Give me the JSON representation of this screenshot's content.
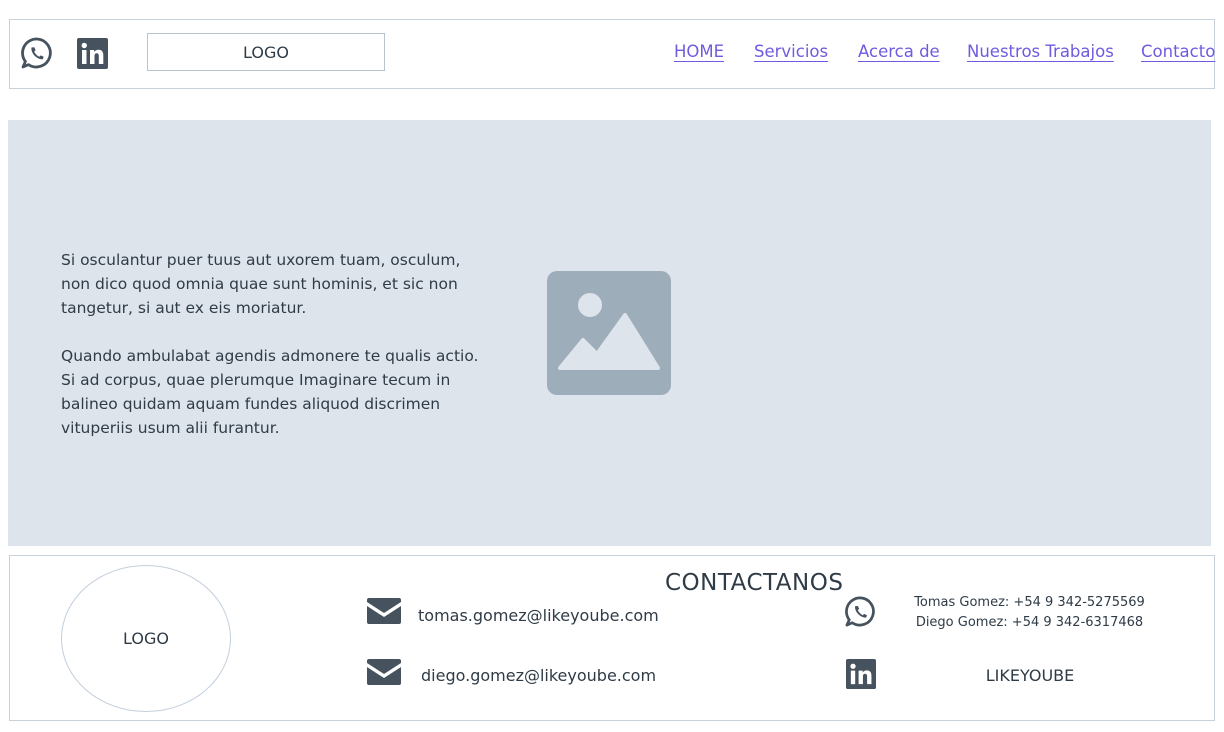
{
  "header": {
    "whatsapp_icon": "whatsapp-icon",
    "linkedin_icon": "linkedin-icon",
    "logo_text": "LOGO",
    "nav": [
      "HOME",
      "Servicios",
      "Acerca de",
      "Nuestros Trabajos",
      "Contacto"
    ],
    "nav_color": "#6e5be0"
  },
  "hero": {
    "paragraph_1": "Si osculantur puer tuus aut uxorem tuam, osculum, non dico quod omnia quae sunt hominis, et sic non tangetur, si aut ex eis moriatur.",
    "paragraph_2": "Quando ambulabat agendis admonere te qualis actio. Si ad corpus, quae plerumque Imaginare tecum in balineo quidam aquam fundes aliquod discrimen vituperiis usum alii furantur.",
    "image_icon": "image-placeholder-icon",
    "background": "#dee4ec"
  },
  "footer": {
    "logo_text": "LOGO",
    "title": "CONTACTANOS",
    "emails": [
      "tomas.gomez@likeyoube.com",
      "diego.gomez@likeyoube.com"
    ],
    "phones": [
      "Tomas Gomez: +54 9 342-5275569",
      "Diego Gomez: +54 9 342-6317468"
    ],
    "company": "LIKEYOUBE",
    "mail_icon": "mail-icon"
  }
}
